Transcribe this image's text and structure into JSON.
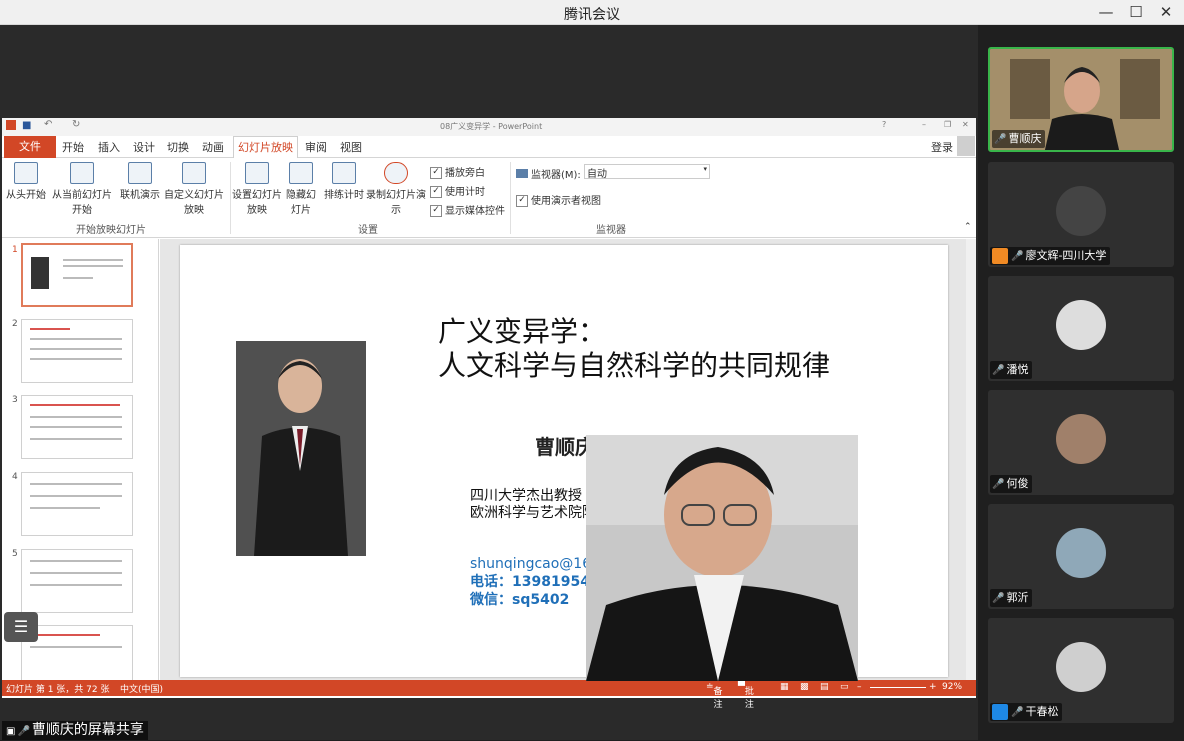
{
  "window": {
    "title": "腾讯会议"
  },
  "ppt": {
    "doc_title": "08广义变异学 - PowerPoint",
    "login": "登录",
    "tabs": [
      "文件",
      "开始",
      "插入",
      "设计",
      "切换",
      "动画",
      "幻灯片放映",
      "审阅",
      "视图"
    ],
    "active_tab": "幻灯片放映",
    "ribbon": {
      "from_start": "从头开始",
      "from_current": "从当前幻灯片开始",
      "online": "联机演示",
      "custom": "自定义幻灯片放映",
      "setup": "设置幻灯片放映",
      "hide": "隐藏幻灯片",
      "rehearse": "排练计时",
      "record": "录制幻灯片演示",
      "play_narration": "播放旁白",
      "use_timing": "使用计时",
      "show_media": "显示媒体控件",
      "monitor_label": "监视器(M):",
      "monitor_value": "自动",
      "presenter_view": "使用演示者视图",
      "group_start": "开始放映幻灯片",
      "group_setup": "设置",
      "group_monitor": "监视器"
    },
    "thumbnails": [
      "1",
      "2",
      "3",
      "4",
      "5",
      "6"
    ],
    "slide": {
      "title_line1": "广义变异学：",
      "title_line2": "人文科学与自然科学的共同规律",
      "name": "曹顺庆",
      "aff1": "四川大学杰出教授",
      "aff2": "欧洲科学与艺术院院士",
      "email": "shunqingcao@163.com",
      "phone": "电话：13981954539",
      "wechat": "微信：sq5402"
    },
    "status": {
      "slide_count": "幻灯片 第 1 张，共 72 张",
      "language": "中文(中国)",
      "notes": "备注",
      "comments": "批注",
      "zoom": "92%"
    }
  },
  "participants": [
    {
      "name": "曹顺庆",
      "mic": "on",
      "active": true
    },
    {
      "name": "廖文辉-四川大学",
      "mic": "off",
      "icon": "orange-user"
    },
    {
      "name": "潘悦",
      "mic": "off"
    },
    {
      "name": "何俊",
      "mic": "off"
    },
    {
      "name": "郭沂",
      "mic": "off"
    },
    {
      "name": "干春松",
      "mic": "off",
      "icon": "blue-user"
    }
  ],
  "share_label": "曹顺庆的屏幕共享"
}
